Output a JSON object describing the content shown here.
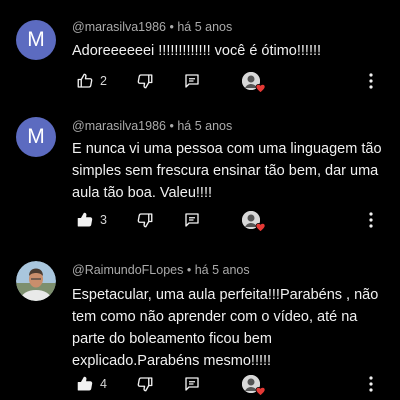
{
  "comments": [
    {
      "avatar_letter": "M",
      "author": "@marasilva1986",
      "time": "há 5 anos",
      "text": "Adoreeeeeei !!!!!!!!!!!!! você é ótimo!!!!!!",
      "likes": "2",
      "liked": false
    },
    {
      "avatar_letter": "M",
      "author": "@marasilva1986",
      "time": "há 5 anos",
      "text": "E nunca vi uma pessoa com uma linguagem tão simples sem frescura ensinar tão bem, dar uma aula tão boa. Valeu!!!!",
      "likes": "3",
      "liked": true
    },
    {
      "avatar_letter": "",
      "author": "@RaimundoFLopes",
      "time": "há 5 anos",
      "text": "Espetacular, uma aula perfeita!!!Parabéns , não tem como não aprender com o vídeo, até na parte do boleamento ficou bem explicado.Parabéns mesmo!!!!!",
      "likes": "4",
      "liked": true
    }
  ],
  "separator": "•",
  "colors": {
    "background": "#000000",
    "avatar_bg": "#5c6bc0",
    "meta": "#aaaaaa",
    "text": "#f1f1f1",
    "heart": "#e53935"
  },
  "icons": {
    "like": "thumb-up-icon",
    "dislike": "thumb-down-icon",
    "reply": "reply-icon",
    "creator_heart": "creator-heart-icon",
    "more": "more-vert-icon"
  }
}
